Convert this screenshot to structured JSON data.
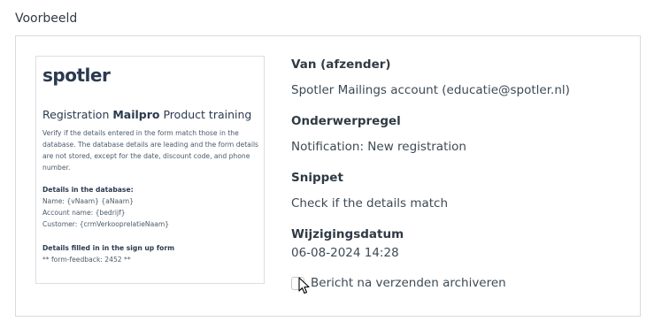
{
  "section_title": "Voorbeeld",
  "preview": {
    "logo": "spotler",
    "heading_pre": "Registration ",
    "heading_bold": "Mailpro",
    "heading_post": " Product training",
    "body_line1": "Verify if the details entered in the form match those in the",
    "body_line2": "database. The database details are leading and the form details",
    "body_line3": "are not stored, except for the date, discount code, and phone",
    "body_line4": "number.",
    "db_title": "Details in the database:",
    "db_name": "Name: {vNaam} {aNaam}",
    "db_account": "Account name: {bedrijf}",
    "db_customer": "Customer: {crmVerkooprelatieNaam}",
    "form_title": "Details filled in in the sign up form",
    "form_feedback": "** form-feedback: 2452 **"
  },
  "meta": {
    "from_label": "Van (afzender)",
    "from_value": "Spotler Mailings account (educatie@spotler.nl)",
    "subject_label": "Onderwerpregel",
    "subject_value": "Notification: New registration",
    "snippet_label": "Snippet",
    "snippet_value": "Check if the details match",
    "modified_label": "Wijzigingsdatum",
    "modified_value": "06-08-2024 14:28"
  },
  "archive_checkbox": {
    "label": "Bericht na verzenden archiveren",
    "checked": false
  }
}
